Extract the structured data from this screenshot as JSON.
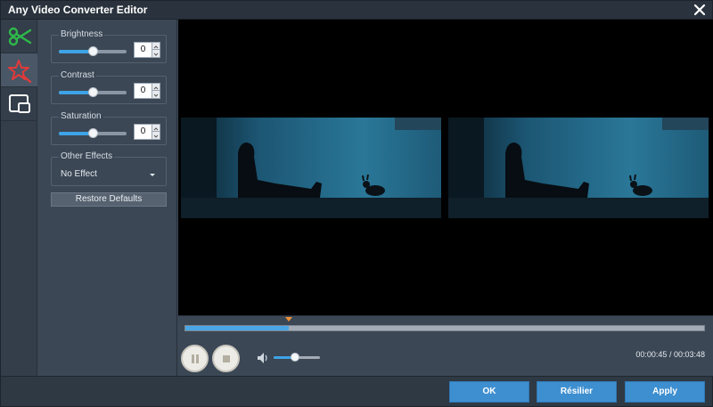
{
  "window": {
    "title": "Any Video Converter Editor"
  },
  "tabs": [
    {
      "icon": "scissors-icon",
      "color": "#2eb84a",
      "active": false
    },
    {
      "icon": "effects-star-icon",
      "color": "#e23a3a",
      "active": true
    },
    {
      "icon": "crop-frame-icon",
      "color": "#ffffff",
      "active": false
    }
  ],
  "effects": {
    "brightness": {
      "label": "Brightness",
      "value": "0",
      "level": 0.5
    },
    "contrast": {
      "label": "Contrast",
      "value": "0",
      "level": 0.5
    },
    "saturation": {
      "label": "Saturation",
      "value": "0",
      "level": 0.5
    },
    "other_effects": {
      "label": "Other Effects",
      "selected": "No Effect"
    },
    "restore_label": "Restore Defaults"
  },
  "player": {
    "progress": 0.2,
    "volume": 0.47,
    "current_time": "00:00:45",
    "separator": " / ",
    "total_time": "00:03:48",
    "accent": "#4aa6e6",
    "marker_color": "#f29035"
  },
  "footer": {
    "ok_label": "OK",
    "cancel_label": "Résilier",
    "apply_label": "Apply",
    "button_color": "#3e8fd0"
  }
}
